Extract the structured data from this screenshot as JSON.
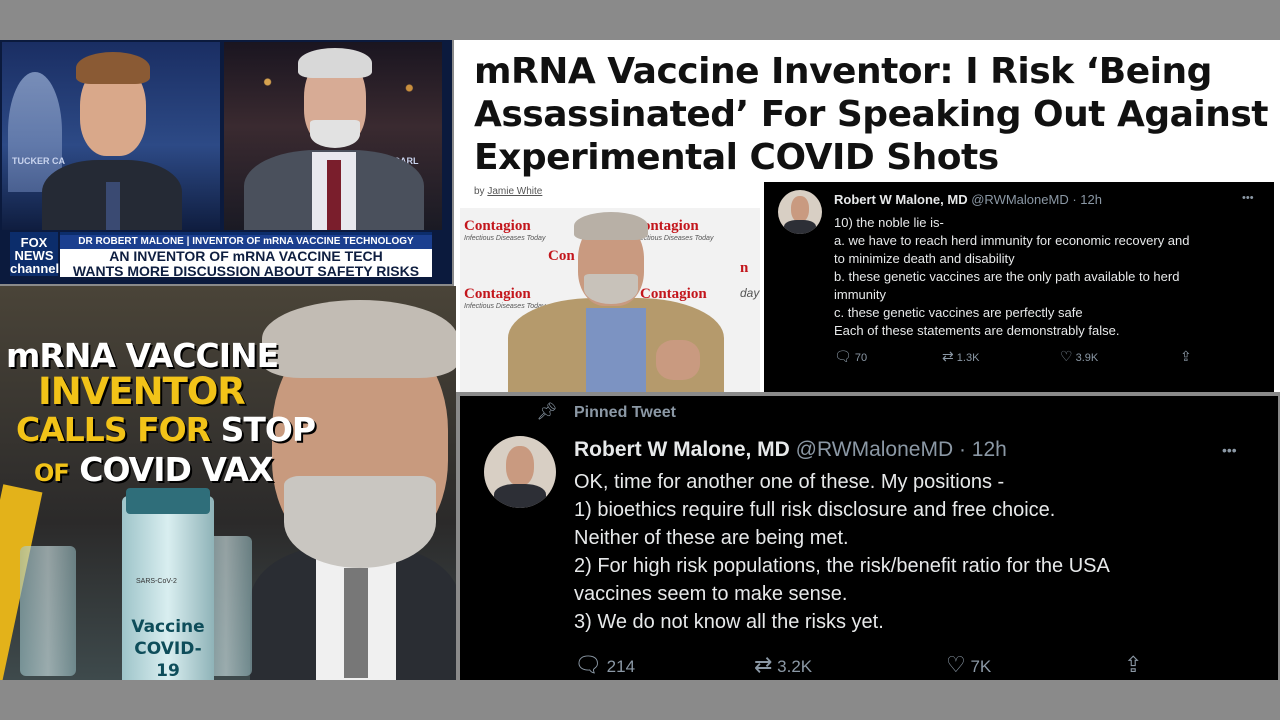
{
  "fox_panel": {
    "network_logo": "FOX NEWS channel",
    "bg_text_left": "TUCKER CA",
    "bg_text_right": "KER CARL",
    "lower_third_top": "DR ROBERT MALONE | INVENTOR OF mRNA VACCINE TECHNOLOGY",
    "lower_third_line1": "AN INVENTOR OF mRNA VACCINE TECH",
    "lower_third_line2": "WANTS MORE DISCUSSION ABOUT SAFETY RISKS"
  },
  "article": {
    "headline_line1": "mRNA Vaccine Inventor: I Risk ‘Being",
    "headline_line2": "Assassinated’ For Speaking Out Against",
    "headline_line3": "Experimental COVID Shots",
    "byline_prefix": "by",
    "byline_author": "Jamie White"
  },
  "contagion_panel": {
    "brand": "Contagion",
    "brand_partial1": "Con",
    "brand_partial2": "n",
    "brand_partial3": "day",
    "subtitle": "Infectious Diseases Today"
  },
  "poster": {
    "line1": "mRNA VACCINE",
    "line2": "INVENTOR",
    "line3a": "CALLS FOR",
    "line3b": "STOP",
    "line4a": "OF",
    "line4b": "COVID VAX",
    "vial_small": "SARS-CoV-2",
    "vial_label1": "Vaccine",
    "vial_label2": "COVID-19"
  },
  "tweet_small": {
    "name": "Robert W Malone, MD",
    "handle": "@RWMaloneMD",
    "time": "· 12h",
    "more": "•••",
    "lines": [
      "10) the noble lie is-",
      "a. we have to reach herd immunity for economic recovery and",
      "to minimize death and disability",
      "b. these genetic vaccines are the only path available to herd",
      "immunity",
      "c. these genetic vaccines are perfectly safe",
      "Each of these statements are demonstrably false."
    ],
    "replies": "70",
    "retweets": "1.3K",
    "likes": "3.9K"
  },
  "tweet_large": {
    "pinned": "Pinned Tweet",
    "name": "Robert W Malone, MD",
    "handle": "@RWMaloneMD",
    "time": "· 12h",
    "more": "•••",
    "lines": [
      "OK, time for another one of these.  My positions -",
      "1) bioethics require full risk disclosure and free choice.",
      "Neither of these are being met.",
      "2) For high risk populations, the risk/benefit ratio for the USA",
      "vaccines seem to make sense.",
      "3) We do not know all the risks yet."
    ],
    "replies": "214",
    "retweets": "3.2K",
    "likes": "7K"
  },
  "colors": {
    "frame": "#8a8a8a",
    "tweet_bg": "#000000",
    "tweet_text": "#e7e9ea",
    "tweet_muted": "#8b98a5",
    "fox_blue": "#1b3f8f",
    "poster_yellow": "#f2c318",
    "contagion_red": "#c3161c"
  },
  "icons": [
    "reply-icon",
    "retweet-icon",
    "like-icon",
    "share-icon",
    "pin-icon",
    "more-icon"
  ]
}
